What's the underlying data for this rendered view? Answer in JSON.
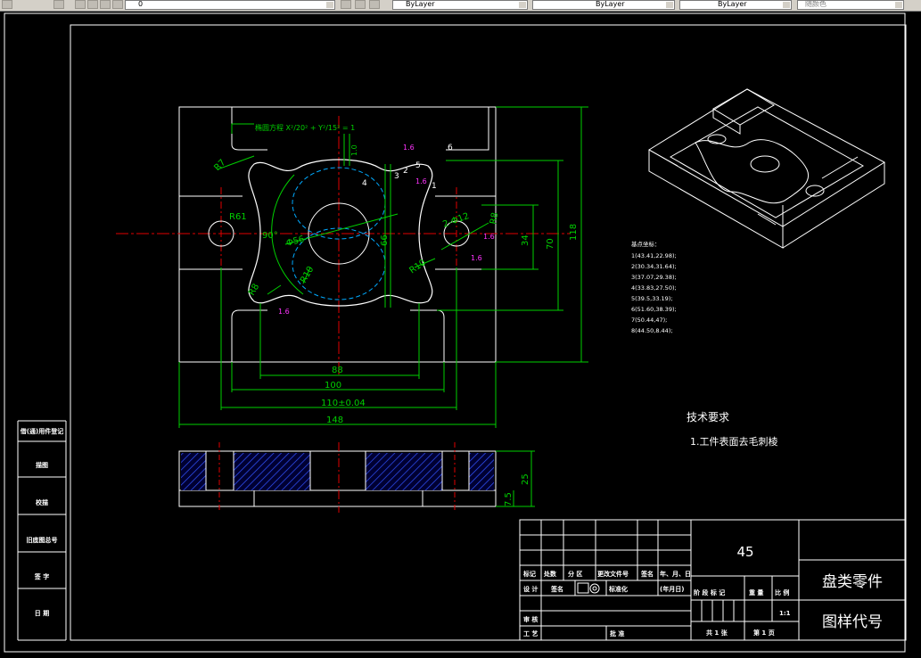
{
  "toolbar": {
    "layer_value": "0",
    "color_value": "ByLayer",
    "linetype_value": "ByLayer",
    "lineweight_value": "ByLayer",
    "plotstyle_value": "随颜色"
  },
  "drawing": {
    "dims": {
      "r7": "R7",
      "r61": "R61",
      "r10_left": "R10",
      "r10_right": "R10",
      "r8_left": "R8",
      "angle90": "90°",
      "dia56": "Φ56",
      "dia12": "2-Φ12",
      "r8_right": "R8",
      "dim66": "66",
      "dim34": "34",
      "dim70": "70",
      "dim118": "118",
      "dim88": "88",
      "dim100": "100",
      "dim110": "110±0.04",
      "dim148": "148",
      "dim1": "1.0",
      "dim25": "25",
      "dim75": "7.5",
      "ellipse_eq": "椭圆方程 X²/20² + Y²/15² = 1",
      "rough": [
        "1.6",
        "1.6",
        "1.6",
        "1.6",
        "1.6"
      ],
      "point_labels": [
        "1",
        "2",
        "3",
        "4",
        "5",
        "6"
      ]
    },
    "coords": {
      "title": "基点坐标：",
      "items": [
        "1(43.41,22.98);",
        "2(30.34,31.64);",
        "3(37.07,29.38);",
        "4(33.83,27.50);",
        "5(39.5,33.19);",
        "6(51.60,38.39);",
        "7(50.44,47);",
        "8(44.50,8.44);"
      ]
    },
    "tech": {
      "title": "技术要求",
      "item1": "1.工件表面去毛刺棱"
    },
    "left_strip": [
      "借(通)用件登记",
      "描图",
      "校描",
      "旧底图总号",
      "签 字",
      "日 期"
    ],
    "title_block": {
      "material": "45",
      "part_name": "盘类零件",
      "drawing_code": "图样代号",
      "row_marks": [
        "标记",
        "处数",
        "分 区",
        "更改文件号",
        "签名",
        "年、月、日"
      ],
      "row_design": [
        "设 计",
        "签名",
        "标准化",
        "(年月日)"
      ],
      "row_review": "审 核",
      "row_process": "工 艺",
      "row_approve": "批 准",
      "stage_labels": [
        "阶 段 标 记",
        "重 量",
        "比 例"
      ],
      "scale": "1:1",
      "sheets": "共 1 张",
      "sheet_no": "第 1 页"
    }
  }
}
